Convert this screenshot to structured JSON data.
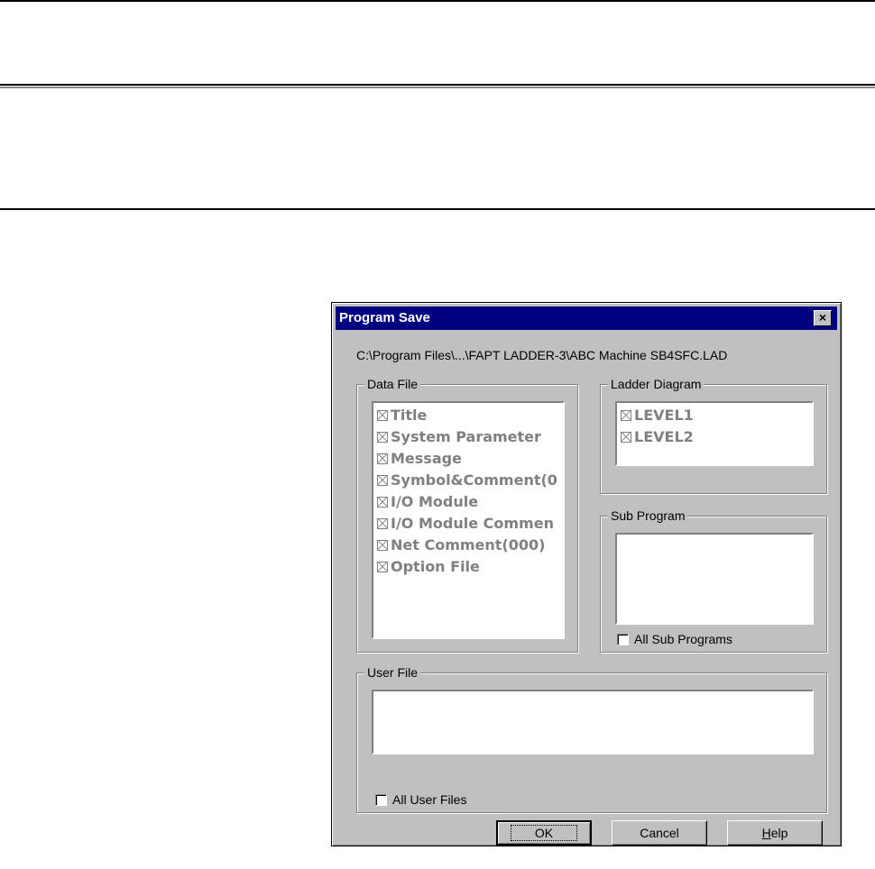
{
  "dialog": {
    "title": "Program Save",
    "close_glyph": "×",
    "path": "C:\\Program Files\\...\\FAPT LADDER-3\\ABC Machine SB4SFC.LAD"
  },
  "data_file": {
    "label": "Data File",
    "items": [
      "Title",
      "System Parameter",
      "Message",
      "Symbol&Comment(0",
      "I/O Module",
      "I/O Module Commen",
      "Net Comment(000)",
      "Option File"
    ]
  },
  "ladder_diagram": {
    "label": "Ladder Diagram",
    "items": [
      "LEVEL1",
      "LEVEL2"
    ]
  },
  "sub_program": {
    "label": "Sub Program",
    "all_label": "All Sub Programs"
  },
  "user_file": {
    "label": "User File",
    "all_label": "All User Files"
  },
  "buttons": {
    "ok": "OK",
    "cancel": "Cancel",
    "help_mnemonic": "H",
    "help_rest": "elp"
  }
}
